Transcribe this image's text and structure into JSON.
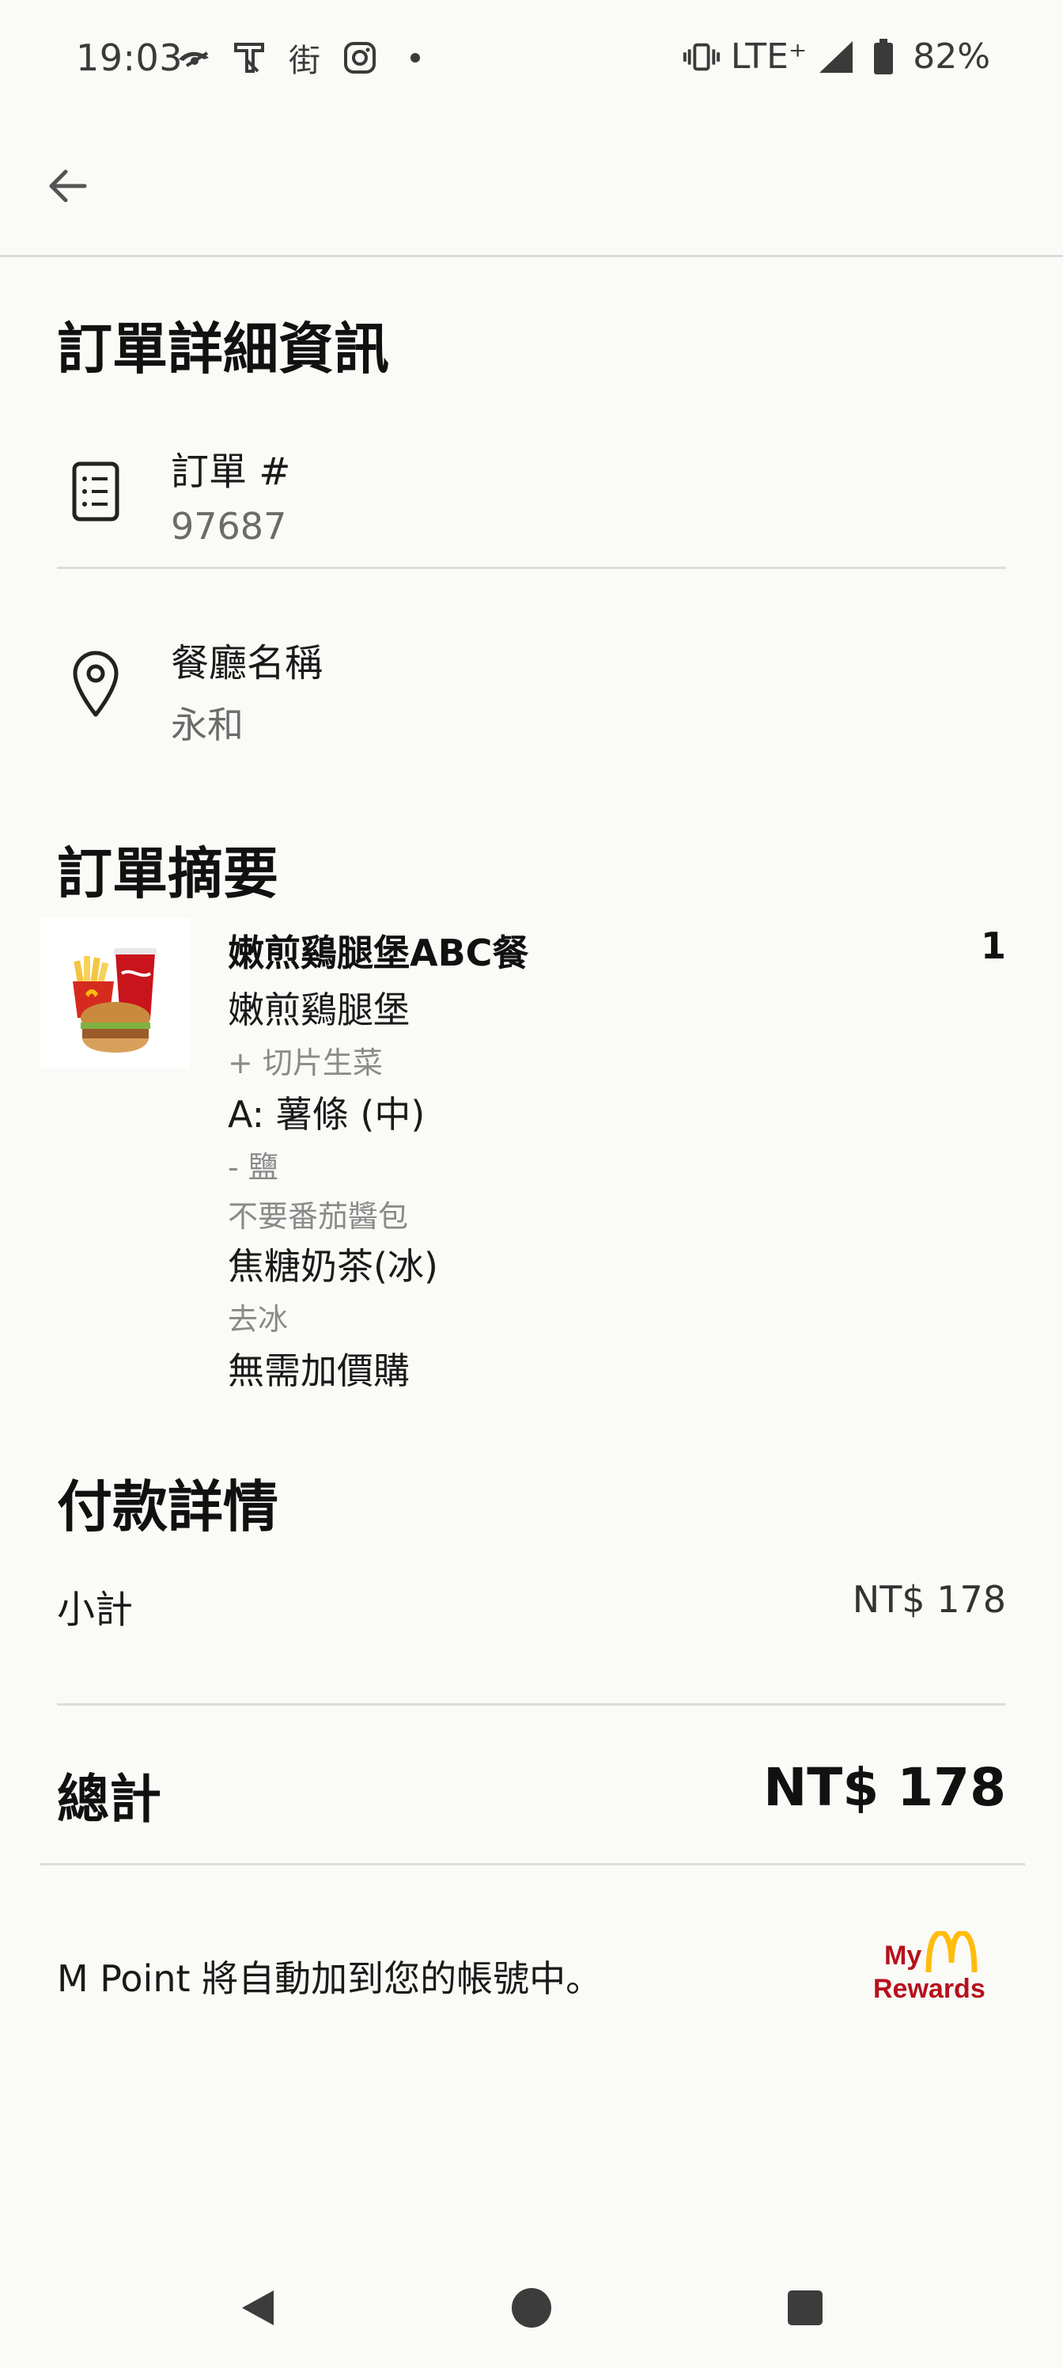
{
  "status_bar": {
    "time": "19:03",
    "network": "LTE⁺",
    "battery": "82%",
    "left_icons": [
      "cast-icon",
      "app-icon",
      "street-icon",
      "instagram-icon",
      "dot-icon"
    ],
    "street_glyph": "街"
  },
  "page": {
    "title": "訂單詳細資訊"
  },
  "order": {
    "number_label": "訂單 #",
    "number_value": "97687"
  },
  "restaurant": {
    "label": "餐廳名稱",
    "value": "永和"
  },
  "summary": {
    "title": "訂單摘要",
    "items": [
      {
        "name": "嫩煎鷄腿堡ABC餐",
        "quantity": "1",
        "burger": "嫩煎鷄腿堡",
        "burger_mod": "+ 切片生菜",
        "side": "A: 薯條 (中)",
        "side_mod_1": "- 鹽",
        "side_mod_2": "不要番茄醬包",
        "drink": "焦糖奶茶(冰)",
        "drink_mod": "去冰",
        "addon": "無需加價購"
      }
    ]
  },
  "payment": {
    "title": "付款詳情",
    "subtotal_label": "小計",
    "subtotal_value": "NT$ 178",
    "total_label": "總計",
    "total_value": "NT$ 178"
  },
  "rewards": {
    "message": "M Point 將自動加到您的帳號中。",
    "logo_top": "My",
    "logo_bottom": "Rewards",
    "colors": {
      "brand_red": "#b5121b",
      "brand_gold": "#ffbc0d"
    }
  },
  "nav": {
    "back": "back-triangle-icon",
    "home": "home-circle-icon",
    "recents": "recents-square-icon"
  }
}
